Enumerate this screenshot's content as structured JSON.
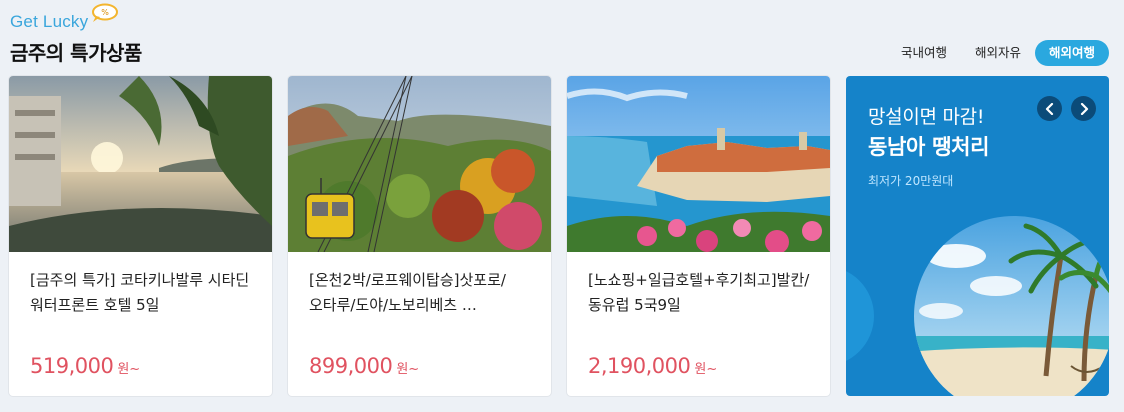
{
  "header": {
    "brand": "Get Lucky",
    "brand_badge": "%",
    "title": "금주의 특가상품"
  },
  "tabs": [
    {
      "label": "국내여행",
      "active": false
    },
    {
      "label": "해외자유",
      "active": false
    },
    {
      "label": "해외여행",
      "active": true
    }
  ],
  "products": [
    {
      "name": "[금주의 특가] 코타키나발루 시타딘 워터프론트 호텔 5일",
      "price": "519,000",
      "unit": "원~",
      "image": "infinity-pool-sunset"
    },
    {
      "name": "[온천2박/로프웨이탑승]삿포로/오타루/도야/노보리베츠 …",
      "price": "899,000",
      "unit": "원~",
      "image": "ropeway-autumn-mountain"
    },
    {
      "name": "[노쇼핑+일급호텔+후기최고]발칸/동유럽 5국9일",
      "price": "2,190,000",
      "unit": "원~",
      "image": "dubrovnik-coast"
    }
  ],
  "promo": {
    "line1": "망설이면 마감!",
    "line2": "동남아 땡처리",
    "line3": "최저가 20만원대",
    "background": "#1583c9",
    "image": "palm-beach"
  },
  "colors": {
    "accent": "#2aa8df",
    "price": "#e05260",
    "page_bg": "#edf1f6"
  }
}
